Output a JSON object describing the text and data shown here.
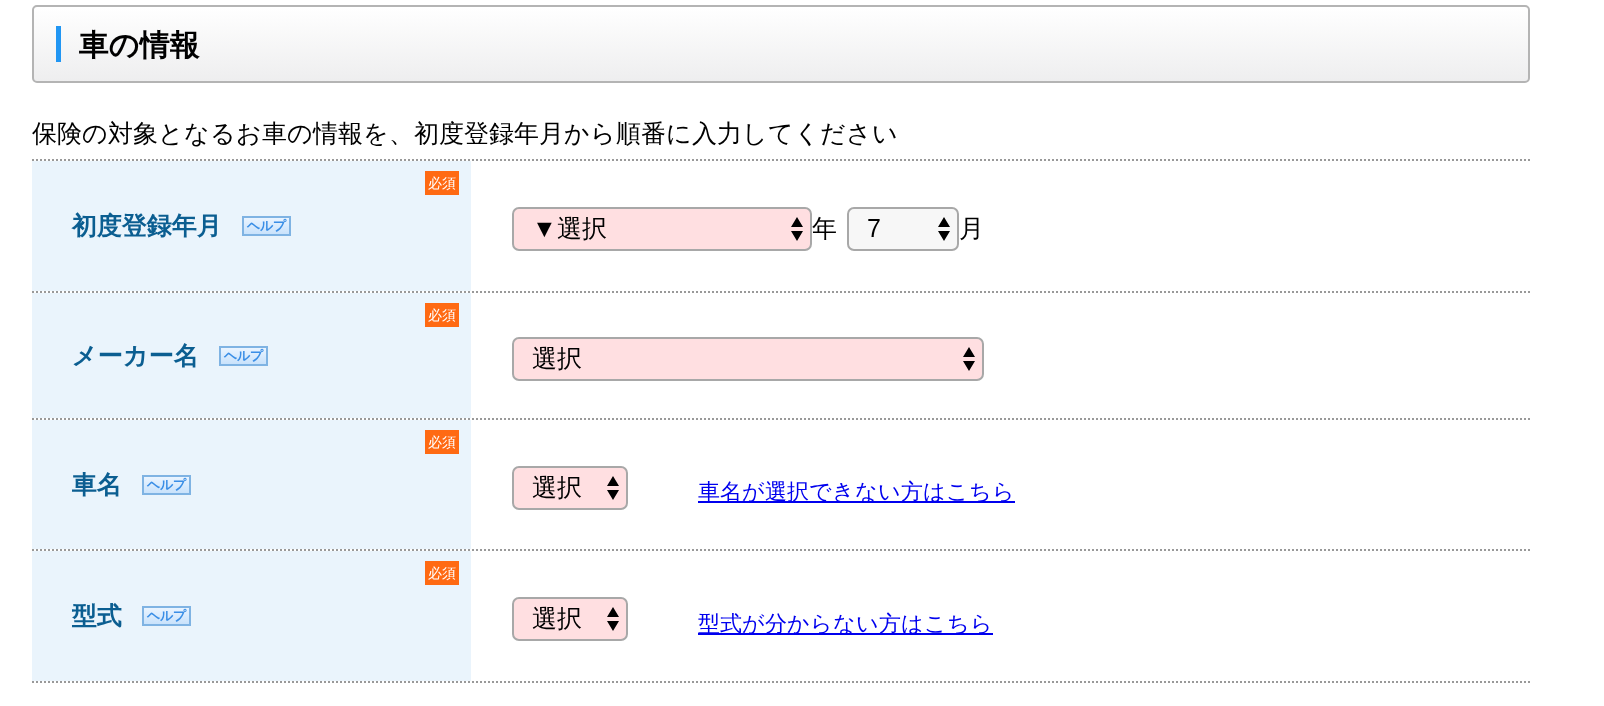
{
  "section": {
    "title": "車の情報"
  },
  "intro": "保険の対象となるお車の情報を、初度登録年月から順番に入力してください",
  "rows": [
    {
      "label": "初度登録年月",
      "help": "ヘルプ",
      "badge": "必須",
      "controls": [
        {
          "kind": "select",
          "value": "▼選択",
          "highlighted": true
        },
        {
          "kind": "unit",
          "text": "年"
        },
        {
          "kind": "select",
          "value": "7",
          "highlighted": false
        },
        {
          "kind": "unit",
          "text": "月"
        }
      ]
    },
    {
      "label": "メーカー名",
      "help": "ヘルプ",
      "badge": "必須",
      "controls": [
        {
          "kind": "select",
          "value": "選択",
          "highlighted": true
        }
      ]
    },
    {
      "label": "車名",
      "help": "ヘルプ",
      "badge": "必須",
      "controls": [
        {
          "kind": "select",
          "value": "選択",
          "highlighted": true
        },
        {
          "kind": "link",
          "text": "車名が選択できない方はこちら"
        }
      ]
    },
    {
      "label": "型式",
      "help": "ヘルプ",
      "badge": "必須",
      "controls": [
        {
          "kind": "select",
          "value": "選択",
          "highlighted": true
        },
        {
          "kind": "link",
          "text": "型式が分からない方はこちら"
        }
      ]
    }
  ]
}
